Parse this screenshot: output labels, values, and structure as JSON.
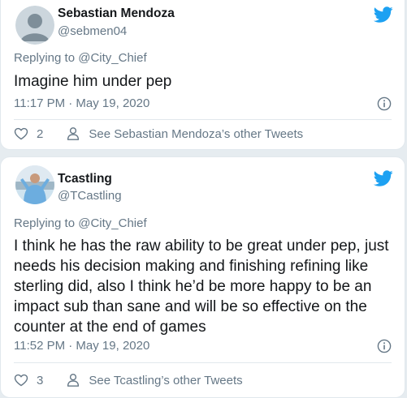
{
  "colors": {
    "twitter_blue": "#1da1f2",
    "secondary_text": "#657786",
    "primary_text": "#14171a",
    "background": "#e6ecf0"
  },
  "tweets": [
    {
      "display_name": "Sebastian Mendoza",
      "handle": "@sebmen04",
      "avatar": "default-avatar",
      "replying_to_prefix": "Replying to",
      "replying_to_handle": "@City_Chief",
      "text": "Imagine him under pep",
      "timestamp": "11:17 PM · May 19, 2020",
      "like_count": "2",
      "other_tweets_label": "See Sebastian Mendoza’s other Tweets"
    },
    {
      "display_name": "Tcastling",
      "handle": "@TCastling",
      "avatar": "profile-photo-avatar",
      "replying_to_prefix": "Replying to",
      "replying_to_handle": "@City_Chief",
      "text": "I think he has the raw ability to be great under pep, just needs his decision making and finishing refining like sterling did, also I think he’d be more happy to be an impact sub than sane and will be so effective on the counter at the end of games",
      "timestamp": "11:52 PM · May 19, 2020",
      "like_count": "3",
      "other_tweets_label": "See Tcastling’s other Tweets"
    }
  ]
}
